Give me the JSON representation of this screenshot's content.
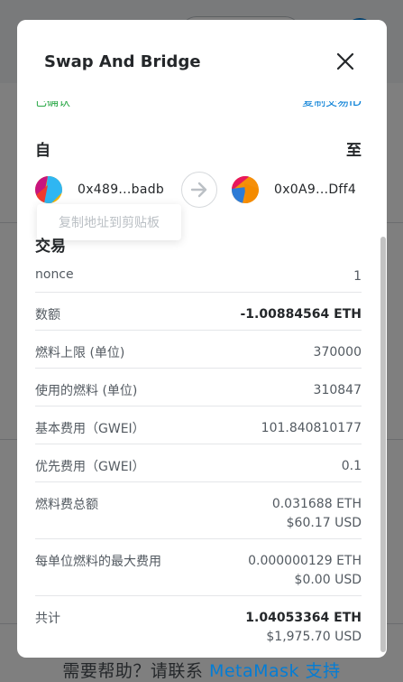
{
  "modal": {
    "title": "Swap And Bridge",
    "partial_status_left": "已确认",
    "partial_status_right": "复制交易ID",
    "from_label": "自",
    "to_label": "至",
    "from_address": "0x489...badb",
    "to_address": "0x0A9...Dff4",
    "copy_tooltip": "复制地址到剪贴板",
    "section_title": "交易",
    "rows": [
      {
        "label": "nonce",
        "value": "1"
      },
      {
        "label": "数额",
        "value": "-1.00884564 ETH"
      },
      {
        "label": "燃料上限 (单位)",
        "value": "370000"
      },
      {
        "label": "使用的燃料 (单位)",
        "value": "310847"
      },
      {
        "label": "基本费用（GWEI）",
        "value": "101.840810177"
      },
      {
        "label": "优先费用（GWEI）",
        "value": "0.1"
      },
      {
        "label": "燃料费总额",
        "value": "0.031688 ETH",
        "sub": "$60.17 USD"
      },
      {
        "label": "每单位燃料的最大费用",
        "value": "0.000000129 ETH",
        "sub": "$0.00 USD"
      },
      {
        "label": "共计",
        "value": "1.04053364 ETH",
        "sub": "$1,975.70 USD"
      }
    ]
  },
  "footer": {
    "help_prefix": "需要帮助？请联系 ",
    "help_link": "MetaMask 支持"
  },
  "colors": {
    "accent": "#037dd6",
    "success": "#28a745",
    "text": "#24272a",
    "muted": "#535a61"
  },
  "icons": [
    "close-icon",
    "arrow-right-icon",
    "identicon"
  ]
}
